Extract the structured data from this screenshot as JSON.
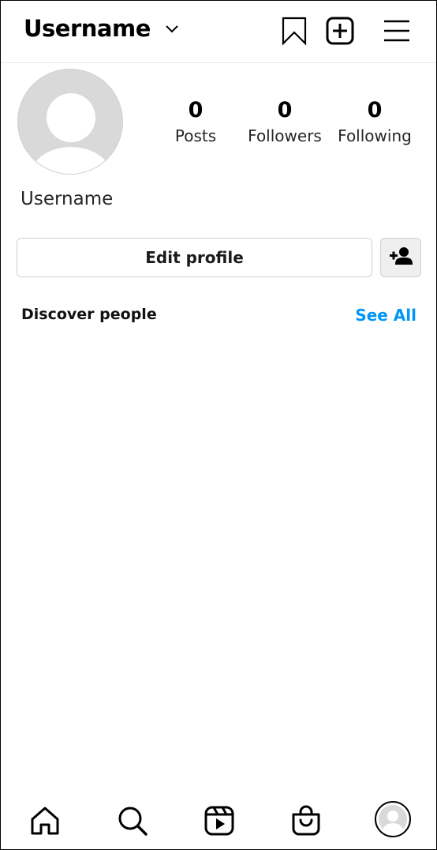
{
  "header": {
    "username": "Username",
    "icons": [
      "chevron-down-icon",
      "bookmark-icon",
      "new-post-icon",
      "menu-icon"
    ]
  },
  "profile": {
    "display_name": "Username",
    "stats": [
      {
        "value": "0",
        "label": "Posts"
      },
      {
        "value": "0",
        "label": "Followers"
      },
      {
        "value": "0",
        "label": "Following"
      }
    ]
  },
  "actions": {
    "edit_profile_label": "Edit profile",
    "add_person_icon": "add-person-icon"
  },
  "discover": {
    "title": "Discover people",
    "see_all_label": "See All",
    "see_all_color": "#0095f6"
  },
  "bottom_nav": {
    "items": [
      "home-icon",
      "search-icon",
      "reels-icon",
      "shop-icon",
      "profile-avatar"
    ]
  }
}
